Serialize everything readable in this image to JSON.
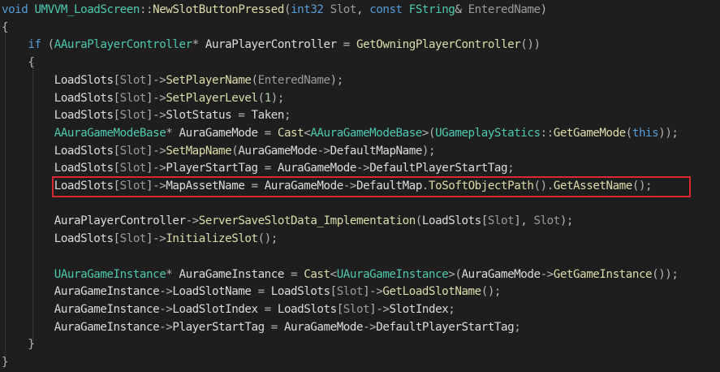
{
  "colors": {
    "background": "#1e1e1e",
    "highlight_box": "#d9282f"
  },
  "code_lines": [
    [
      [
        "void ",
        "kw"
      ],
      [
        "UMVVM_LoadScreen",
        "type"
      ],
      [
        "::",
        "op"
      ],
      [
        "NewSlotButtonPressed",
        "fn"
      ],
      [
        "(",
        "p"
      ],
      [
        "int32 ",
        "kw"
      ],
      [
        "Slot",
        "param"
      ],
      [
        ", ",
        "p"
      ],
      [
        "const ",
        "kw"
      ],
      [
        "FString",
        "type"
      ],
      [
        "& ",
        "p"
      ],
      [
        "EnteredName",
        "param"
      ],
      [
        ")",
        "p"
      ]
    ],
    [
      [
        "{",
        "p"
      ]
    ],
    [
      [
        "    ",
        ""
      ],
      [
        "if ",
        "kw"
      ],
      [
        "(",
        "p"
      ],
      [
        "AAuraPlayerController",
        "type"
      ],
      [
        "* ",
        "p"
      ],
      [
        "AuraPlayerController",
        "var"
      ],
      [
        " = ",
        "p"
      ],
      [
        "GetOwningPlayerController",
        "fn"
      ],
      [
        "())",
        "p"
      ]
    ],
    [
      [
        "    ",
        ""
      ],
      [
        "{",
        "p"
      ]
    ],
    [
      [
        "        ",
        ""
      ],
      [
        "LoadSlots",
        "var"
      ],
      [
        "[",
        "p"
      ],
      [
        "Slot",
        "param"
      ],
      [
        "]->",
        "p"
      ],
      [
        "SetPlayerName",
        "fn"
      ],
      [
        "(",
        "p"
      ],
      [
        "EnteredName",
        "param"
      ],
      [
        ");",
        "p"
      ]
    ],
    [
      [
        "        ",
        ""
      ],
      [
        "LoadSlots",
        "var"
      ],
      [
        "[",
        "p"
      ],
      [
        "Slot",
        "param"
      ],
      [
        "]->",
        "p"
      ],
      [
        "SetPlayerLevel",
        "fn"
      ],
      [
        "(",
        "p"
      ],
      [
        "1",
        "num"
      ],
      [
        ");",
        "p"
      ]
    ],
    [
      [
        "        ",
        ""
      ],
      [
        "LoadSlots",
        "var"
      ],
      [
        "[",
        "p"
      ],
      [
        "Slot",
        "param"
      ],
      [
        "]->",
        "p"
      ],
      [
        "SlotStatus",
        "var"
      ],
      [
        " = ",
        "p"
      ],
      [
        "Taken",
        "var"
      ],
      [
        ";",
        "p"
      ]
    ],
    [
      [
        "        ",
        ""
      ],
      [
        "AAuraGameModeBase",
        "type"
      ],
      [
        "* ",
        "p"
      ],
      [
        "AuraGameMode",
        "var"
      ],
      [
        " = ",
        "p"
      ],
      [
        "Cast",
        "fn"
      ],
      [
        "<",
        "p"
      ],
      [
        "AAuraGameModeBase",
        "type"
      ],
      [
        ">(",
        "p"
      ],
      [
        "UGameplayStatics",
        "type"
      ],
      [
        "::",
        "op"
      ],
      [
        "GetGameMode",
        "fn"
      ],
      [
        "(",
        "p"
      ],
      [
        "this",
        "kw"
      ],
      [
        "));",
        "p"
      ]
    ],
    [
      [
        "        ",
        ""
      ],
      [
        "LoadSlots",
        "var"
      ],
      [
        "[",
        "p"
      ],
      [
        "Slot",
        "param"
      ],
      [
        "]->",
        "p"
      ],
      [
        "SetMapName",
        "fn"
      ],
      [
        "(",
        "p"
      ],
      [
        "AuraGameMode",
        "var"
      ],
      [
        "->",
        "p"
      ],
      [
        "DefaultMapName",
        "var"
      ],
      [
        ");",
        "p"
      ]
    ],
    [
      [
        "        ",
        ""
      ],
      [
        "LoadSlots",
        "var"
      ],
      [
        "[",
        "p"
      ],
      [
        "Slot",
        "param"
      ],
      [
        "]->",
        "p"
      ],
      [
        "PlayerStartTag",
        "var"
      ],
      [
        " = ",
        "p"
      ],
      [
        "AuraGameMode",
        "var"
      ],
      [
        "->",
        "p"
      ],
      [
        "DefaultPlayerStartTag",
        "var"
      ],
      [
        ";",
        "p"
      ]
    ],
    [
      [
        "        ",
        ""
      ],
      [
        "LoadSlots",
        "var"
      ],
      [
        "[",
        "p"
      ],
      [
        "Slot",
        "param"
      ],
      [
        "]->",
        "p"
      ],
      [
        "MapAssetName",
        "var"
      ],
      [
        " = ",
        "p"
      ],
      [
        "AuraGameMode",
        "var"
      ],
      [
        "->",
        "p"
      ],
      [
        "DefaultMap",
        "var"
      ],
      [
        ".",
        "p"
      ],
      [
        "ToSoftObjectPath",
        "fn"
      ],
      [
        "().",
        "p"
      ],
      [
        "GetAssetName",
        "fn"
      ],
      [
        "();",
        "p"
      ]
    ],
    [],
    [
      [
        "        ",
        ""
      ],
      [
        "AuraPlayerController",
        "var"
      ],
      [
        "->",
        "p"
      ],
      [
        "ServerSaveSlotData_Implementation",
        "fn"
      ],
      [
        "(",
        "p"
      ],
      [
        "LoadSlots",
        "var"
      ],
      [
        "[",
        "p"
      ],
      [
        "Slot",
        "param"
      ],
      [
        "], ",
        "p"
      ],
      [
        "Slot",
        "param"
      ],
      [
        ");",
        "p"
      ]
    ],
    [
      [
        "        ",
        ""
      ],
      [
        "LoadSlots",
        "var"
      ],
      [
        "[",
        "p"
      ],
      [
        "Slot",
        "param"
      ],
      [
        "]->",
        "p"
      ],
      [
        "InitializeSlot",
        "fn"
      ],
      [
        "();",
        "p"
      ]
    ],
    [],
    [
      [
        "        ",
        ""
      ],
      [
        "UAuraGameInstance",
        "type"
      ],
      [
        "* ",
        "p"
      ],
      [
        "AuraGameInstance",
        "var"
      ],
      [
        " = ",
        "p"
      ],
      [
        "Cast",
        "fn"
      ],
      [
        "<",
        "p"
      ],
      [
        "UAuraGameInstance",
        "type"
      ],
      [
        ">(",
        "p"
      ],
      [
        "AuraGameMode",
        "var"
      ],
      [
        "->",
        "p"
      ],
      [
        "GetGameInstance",
        "fn"
      ],
      [
        "());",
        "p"
      ]
    ],
    [
      [
        "        ",
        ""
      ],
      [
        "AuraGameInstance",
        "var"
      ],
      [
        "->",
        "p"
      ],
      [
        "LoadSlotName",
        "var"
      ],
      [
        " = ",
        "p"
      ],
      [
        "LoadSlots",
        "var"
      ],
      [
        "[",
        "p"
      ],
      [
        "Slot",
        "param"
      ],
      [
        "]->",
        "p"
      ],
      [
        "GetLoadSlotName",
        "fn"
      ],
      [
        "();",
        "p"
      ]
    ],
    [
      [
        "        ",
        ""
      ],
      [
        "AuraGameInstance",
        "var"
      ],
      [
        "->",
        "p"
      ],
      [
        "LoadSlotIndex",
        "var"
      ],
      [
        " = ",
        "p"
      ],
      [
        "LoadSlots",
        "var"
      ],
      [
        "[",
        "p"
      ],
      [
        "Slot",
        "param"
      ],
      [
        "]->",
        "p"
      ],
      [
        "SlotIndex",
        "var"
      ],
      [
        ";",
        "p"
      ]
    ],
    [
      [
        "        ",
        ""
      ],
      [
        "AuraGameInstance",
        "var"
      ],
      [
        "->",
        "p"
      ],
      [
        "PlayerStartTag",
        "var"
      ],
      [
        " = ",
        "p"
      ],
      [
        "AuraGameMode",
        "var"
      ],
      [
        "->",
        "p"
      ],
      [
        "DefaultPlayerStartTag",
        "var"
      ],
      [
        ";",
        "p"
      ]
    ],
    [
      [
        "    ",
        ""
      ],
      [
        "}",
        "p"
      ]
    ],
    [
      [
        "}",
        "p"
      ]
    ]
  ],
  "highlighted_line_index": 10
}
